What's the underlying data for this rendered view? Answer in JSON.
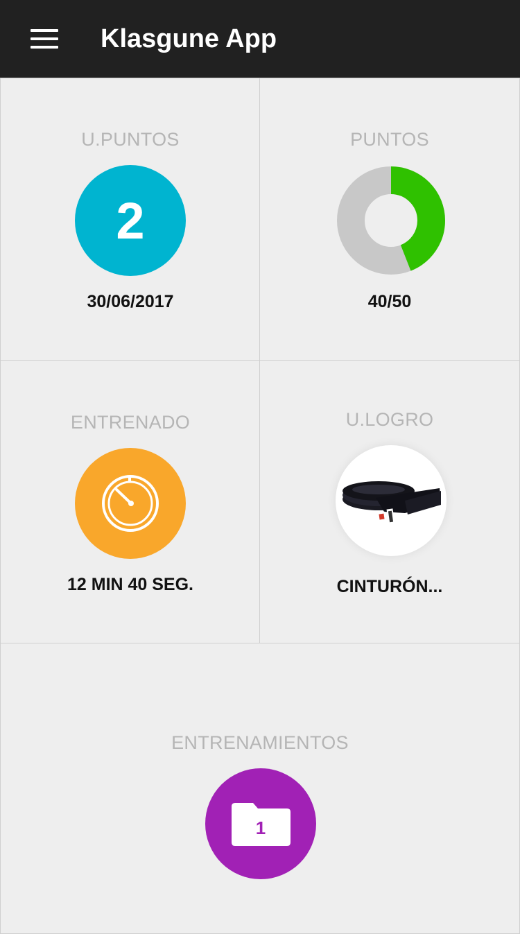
{
  "app": {
    "title": "Klasgune App"
  },
  "colors": {
    "appbar": "#212121",
    "upuntos_circle": "#00b4d0",
    "puntos_filled": "#2fc100",
    "puntos_empty": "#c8c8c8",
    "entrenado_circle": "#f9a72b",
    "entrenamientos_circle": "#a121b5"
  },
  "cards": {
    "u_puntos": {
      "label": "U.PUNTOS",
      "value": "2",
      "date": "30/06/2017"
    },
    "puntos": {
      "label": "PUNTOS",
      "value_text": "40/50",
      "progress_fraction": 0.44
    },
    "entrenado": {
      "label": "ENTRENADO",
      "icon": "stopwatch-icon",
      "value": "12 MIN 40 SEG."
    },
    "u_logro": {
      "label": "U.LOGRO",
      "icon": "black-belt-image",
      "value": "CINTURÓN..."
    },
    "entrenamientos": {
      "label": "ENTRENAMIENTOS",
      "icon": "folder-icon",
      "count": "1"
    }
  }
}
